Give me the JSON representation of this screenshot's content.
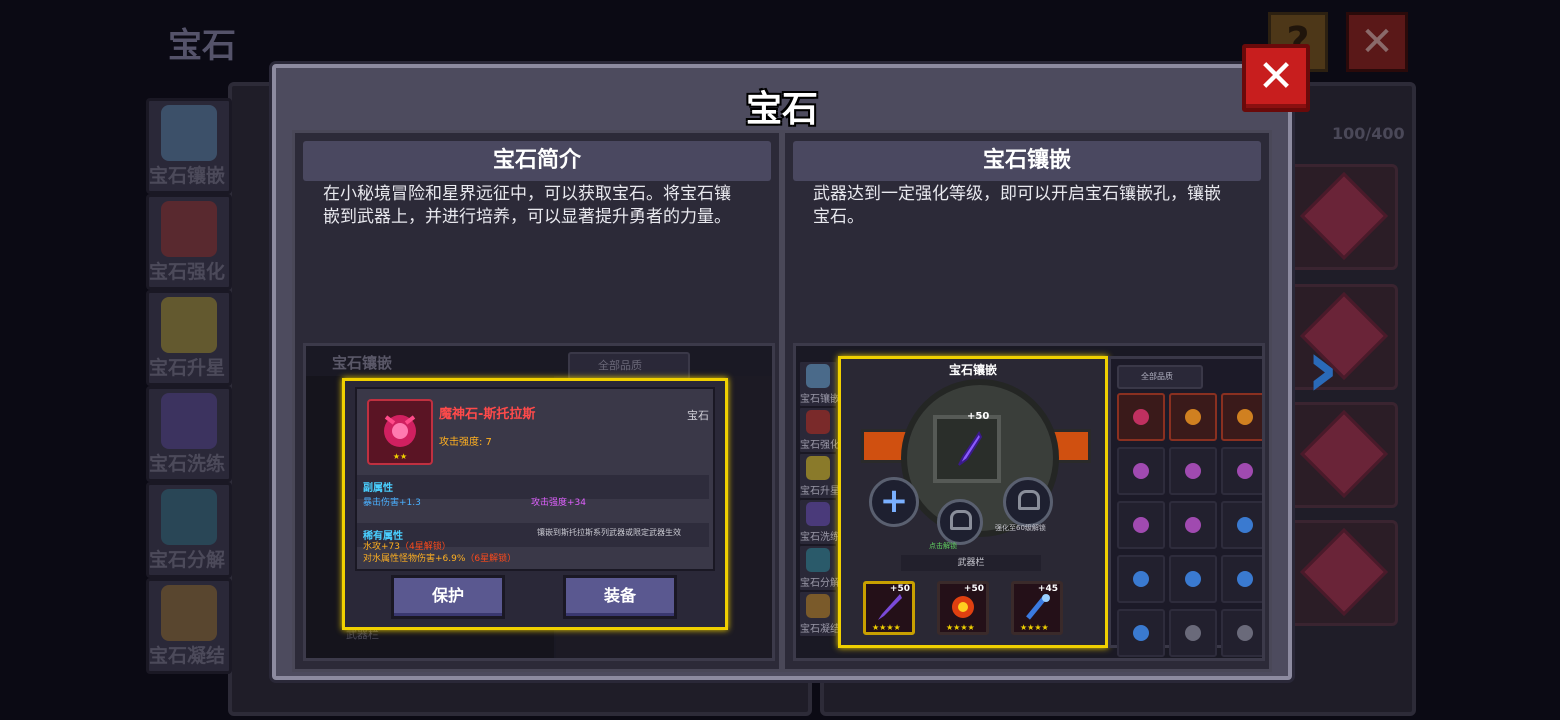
{
  "background": {
    "screen_title": "宝石",
    "capacity": "100/400",
    "sidebar_tabs": [
      {
        "label": "宝石镶嵌",
        "icon": "gem-inlay-icon"
      },
      {
        "label": "宝石强化",
        "icon": "gem-enhance-icon"
      },
      {
        "label": "宝石升星",
        "icon": "gem-star-icon"
      },
      {
        "label": "宝石洗练",
        "icon": "gem-refine-icon"
      },
      {
        "label": "宝石分解",
        "icon": "gem-decompose-icon"
      },
      {
        "label": "宝石凝结",
        "icon": "gem-condense-icon"
      }
    ]
  },
  "dialog": {
    "title": "宝石",
    "close_icon": "close-icon",
    "intro": {
      "heading": "宝石简介",
      "description": "在小秘境冒险和星界远征中，可以获取宝石。将宝石镶嵌到武器上，并进行培养，可以显著提升勇者的力量。",
      "preview": {
        "title": "宝石镶嵌",
        "filter": "全部品质",
        "bottom_label": "武器栏",
        "card": {
          "name": "魔神石-斯托拉斯",
          "type": "宝石",
          "attack": "攻击强度: 7",
          "sub_attr_label": "副属性",
          "sub_attr_1": "暴击伤害+1.3",
          "sub_attr_2": "攻击强度+34",
          "rare_attr_label": "稀有属性",
          "rare_note": "镶嵌到斯托拉斯系列武器或限定武器生效",
          "rare_attr_1": "水攻+73",
          "rare_attr_1_lock": "（4星解锁）",
          "rare_attr_2": "对水属性怪物伤害+6.9%",
          "rare_attr_2_lock": "（6星解锁）",
          "protect_button": "保护",
          "equip_button": "装备"
        }
      }
    },
    "inlay": {
      "heading": "宝石镶嵌",
      "description": "武器达到一定强化等级，即可以开启宝石镶嵌孔，镶嵌宝石。",
      "preview": {
        "panel_title": "宝石镶嵌",
        "filter": "全部品质",
        "socket_bonus": "+50",
        "lock_1_text": "点击解锁",
        "lock_2_text": "强化至60级解锁",
        "weapon_bar_label": "武器栏",
        "weapons": [
          {
            "bonus": "+50",
            "stars": "★★★★",
            "color": "#7a4ad8"
          },
          {
            "bonus": "+50",
            "stars": "★★★★",
            "color": "#e04010"
          },
          {
            "bonus": "+45",
            "stars": "★★★★",
            "color": "#3a7ae0"
          }
        ],
        "mini_tabs": [
          "宝石镶嵌",
          "宝石强化",
          "宝石升星",
          "宝石洗练",
          "宝石分解",
          "宝石凝结"
        ]
      }
    }
  }
}
